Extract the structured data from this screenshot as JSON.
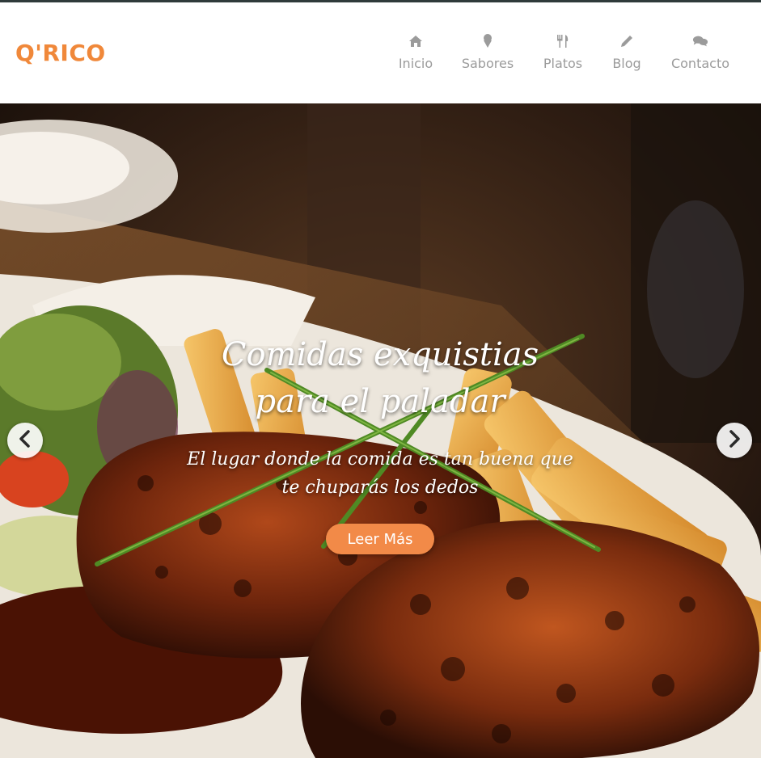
{
  "brand": {
    "logo_text": "Q'RICO",
    "accent_color": "#f0883a"
  },
  "nav": {
    "items": [
      {
        "label": "Inicio",
        "icon": "home-icon"
      },
      {
        "label": "Sabores",
        "icon": "ice-cream-icon"
      },
      {
        "label": "Platos",
        "icon": "utensils-icon"
      },
      {
        "label": "Blog",
        "icon": "pencil-icon"
      },
      {
        "label": "Contacto",
        "icon": "chat-bubbles-icon"
      }
    ],
    "text_color": "#9b9b9b"
  },
  "hero": {
    "title": "Comidas exquistias para el paladar",
    "subtitle": "El lugar donde la comida es tan buena que te chuparás los dedos",
    "cta_label": "Leer Más",
    "cta_color": "#f28a48",
    "prev_icon": "chevron-left-icon",
    "next_icon": "chevron-right-icon"
  }
}
